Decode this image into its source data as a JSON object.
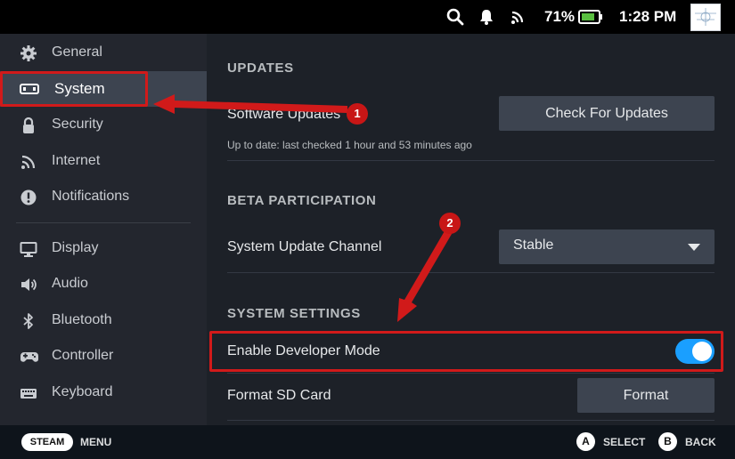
{
  "statusbar": {
    "battery_pct": "71%",
    "clock": "1:28 PM",
    "icons": [
      "search-icon",
      "notification-bell-icon",
      "wifi-icon",
      "battery-icon",
      "avatar"
    ]
  },
  "sidebar": {
    "items": [
      {
        "label": "General",
        "icon": "gear-icon"
      },
      {
        "label": "System",
        "icon": "system-icon",
        "active": true
      },
      {
        "label": "Security",
        "icon": "lock-icon"
      },
      {
        "label": "Internet",
        "icon": "wifi-icon"
      },
      {
        "label": "Notifications",
        "icon": "alert-icon"
      },
      {
        "label": "Display",
        "icon": "monitor-icon"
      },
      {
        "label": "Audio",
        "icon": "speaker-icon"
      },
      {
        "label": "Bluetooth",
        "icon": "bluetooth-icon"
      },
      {
        "label": "Controller",
        "icon": "gamepad-icon"
      },
      {
        "label": "Keyboard",
        "icon": "keyboard-icon"
      }
    ]
  },
  "main": {
    "updates": {
      "title": "UPDATES",
      "software_updates_label": "Software Updates",
      "check_button": "Check For Updates",
      "status": "Up to date: last checked 1 hour and 53 minutes ago"
    },
    "beta": {
      "title": "BETA PARTICIPATION",
      "channel_label": "System Update Channel",
      "channel_value": "Stable"
    },
    "system_settings": {
      "title": "SYSTEM SETTINGS",
      "developer_mode_label": "Enable Developer Mode",
      "developer_mode_on": true,
      "format_sd_label": "Format SD Card",
      "format_button": "Format"
    }
  },
  "bottombar": {
    "steam": "STEAM",
    "menu": "MENU",
    "a_key": "A",
    "select": "SELECT",
    "b_key": "B",
    "back": "BACK"
  },
  "annotations": {
    "badge_1": "1",
    "badge_2": "2",
    "highlight_color": "#d11a1a"
  },
  "colors": {
    "accent": "#1a9fff",
    "sidebar_bg": "#23262e",
    "main_bg": "#1d2128",
    "button_bg": "#3d4450"
  }
}
